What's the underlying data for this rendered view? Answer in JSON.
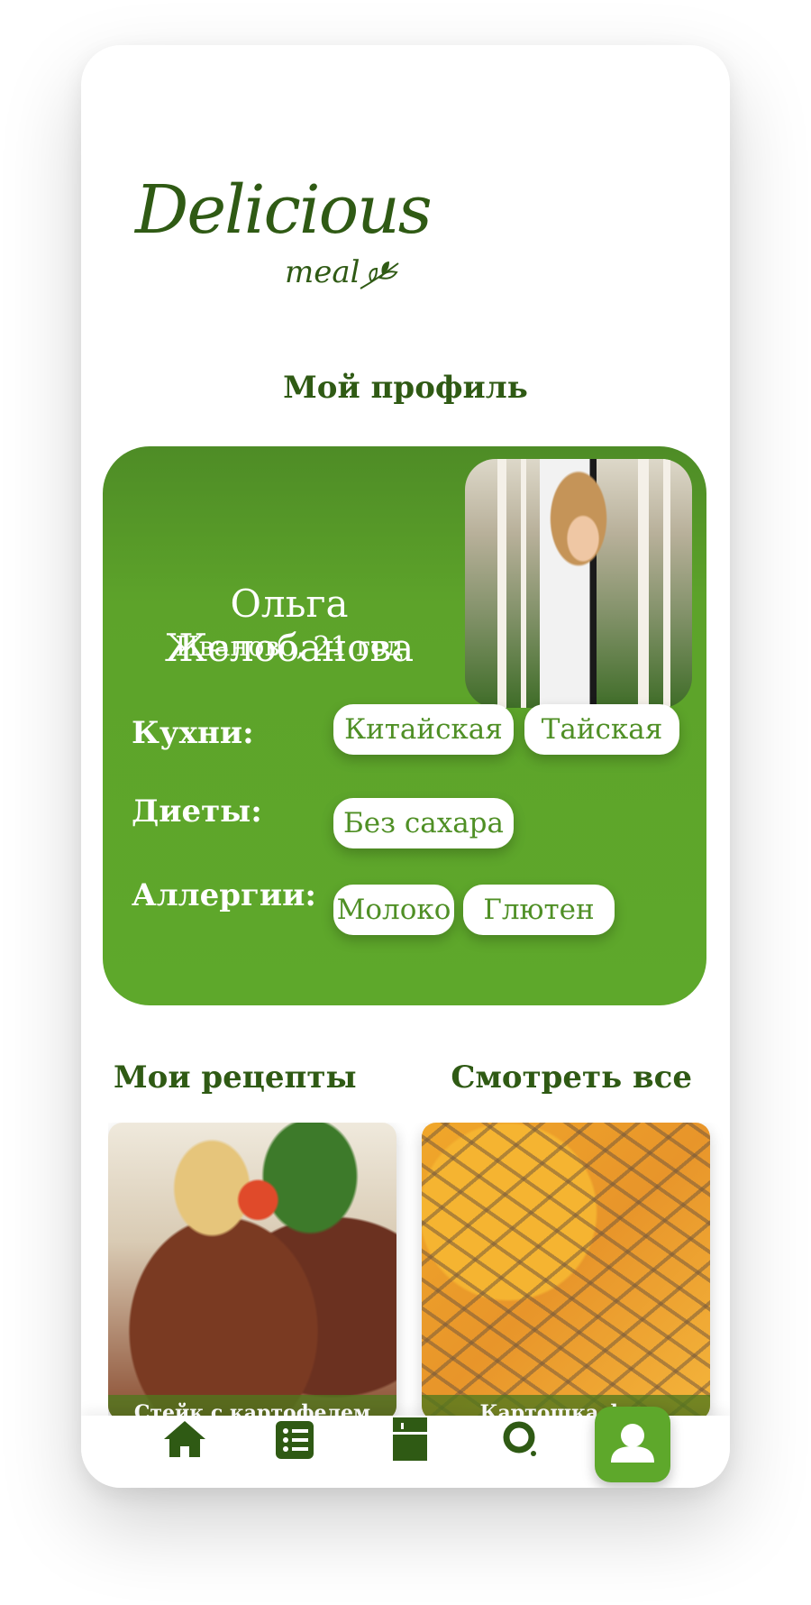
{
  "app": {
    "logo_main": "Delicious",
    "logo_sub": "meal",
    "colors": {
      "primary": "#5ea82b",
      "dark": "#2f5a14",
      "surface": "#ffffff"
    }
  },
  "header": {
    "title": "Мой профиль"
  },
  "profile": {
    "name": "Ольга Желобанова",
    "meta": "Иваново, 21 год",
    "avatar_icon": "user-photo"
  },
  "preferences": {
    "cuisines": {
      "label": "Кухни:",
      "items": [
        "Китайская",
        "Тайская"
      ]
    },
    "diets": {
      "label": "Диеты:",
      "items": [
        "Без сахара"
      ]
    },
    "allergies": {
      "label": "Аллергии:",
      "items": [
        "Молоко",
        "Глютен"
      ]
    }
  },
  "recipes": {
    "title": "Мои рецепты",
    "see_all": "Смотреть все",
    "items": [
      {
        "name": "Стейк с картофелем"
      },
      {
        "name": "Картошка фри"
      }
    ]
  },
  "tabbar": {
    "items": [
      {
        "icon": "home-icon"
      },
      {
        "icon": "list-icon"
      },
      {
        "icon": "fridge-icon"
      },
      {
        "icon": "search-icon"
      },
      {
        "icon": "user-icon",
        "active": true
      }
    ]
  }
}
